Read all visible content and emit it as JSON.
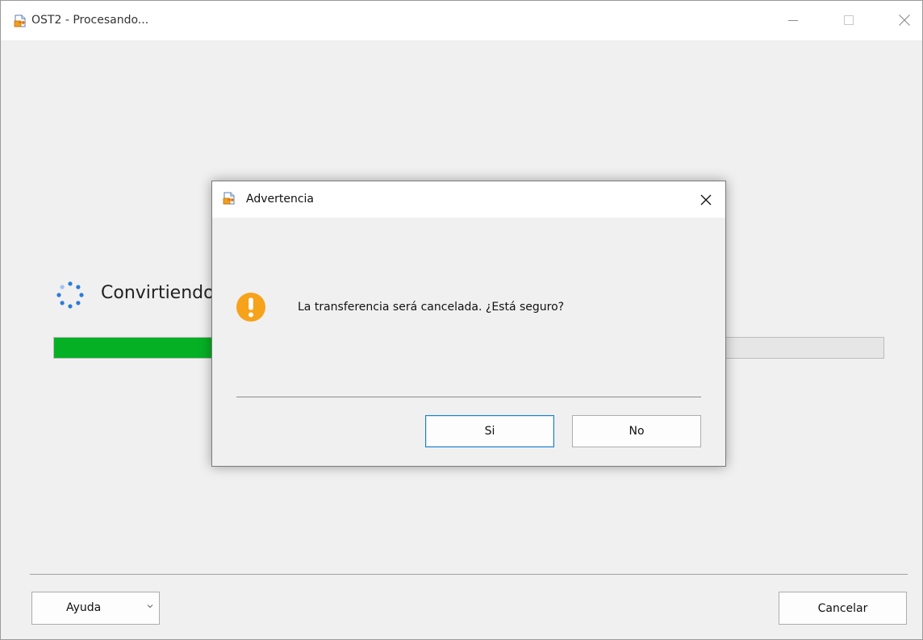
{
  "window": {
    "title": "OST2 - Procesando...",
    "controls": {
      "minimize_icon": "minimize-icon",
      "maximize_icon": "maximize-icon",
      "close_icon": "close-icon"
    }
  },
  "main": {
    "status_text": "Convirtiendo",
    "progress_fraction": 0.52,
    "progress_color": "#06b025"
  },
  "footer": {
    "help_label": "Ayuda",
    "cancel_label": "Cancelar"
  },
  "dialog": {
    "title": "Advertencia",
    "message": "La transferencia será cancelada. ¿Está seguro?",
    "yes_label": "Si",
    "no_label": "No",
    "icon": "warning-icon",
    "accent_color": "#f7a21b"
  }
}
